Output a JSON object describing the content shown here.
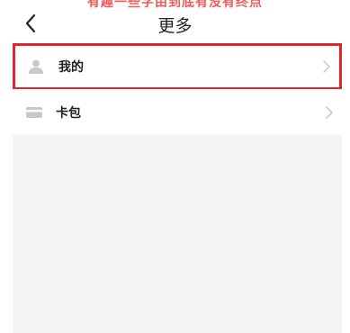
{
  "header": {
    "caption": "有趣一些字由到底有没有终点",
    "title": "更多"
  },
  "menu": {
    "items": [
      {
        "label": "我的",
        "icon": "user-icon",
        "highlighted": true
      },
      {
        "label": "卡包",
        "icon": "card-wallet-icon",
        "highlighted": false
      }
    ]
  },
  "colors": {
    "highlight_border": "#e5232c",
    "caption_text": "#f05a5a",
    "panel_background": "#f5f5f5"
  }
}
